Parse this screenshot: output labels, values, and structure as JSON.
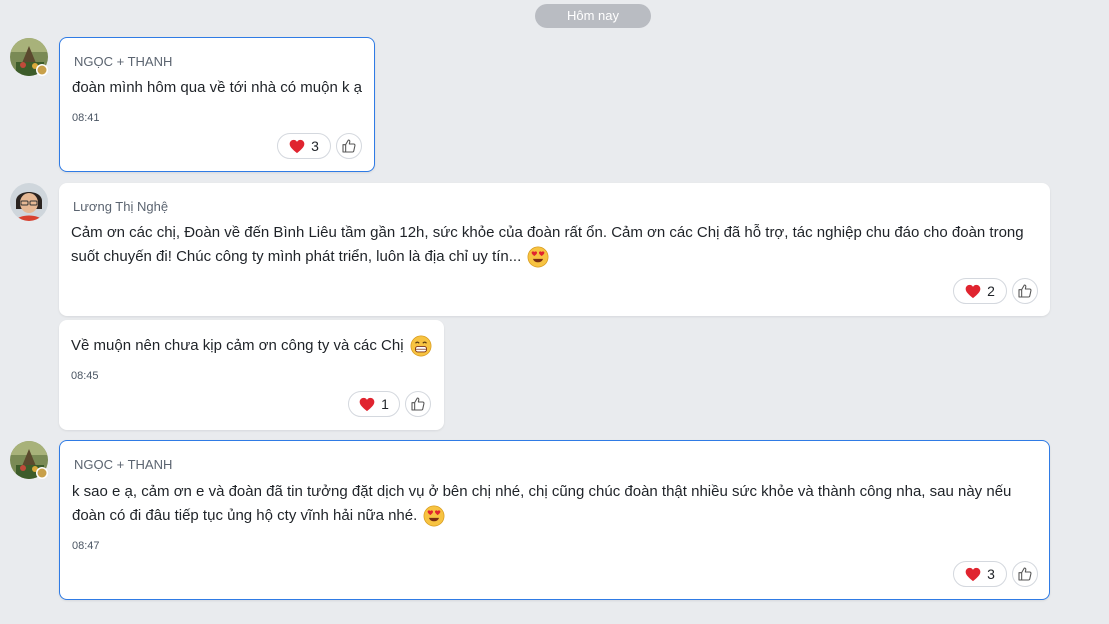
{
  "date_divider": "Hôm nay",
  "messages": [
    {
      "sender": "NGỌC + THANH",
      "line1": "đoàn mình hôm qua về tới nhà có muộn k ạ",
      "time": "08:41",
      "reaction_icon": "heart-icon",
      "reaction_count": "3"
    },
    {
      "sender": "Lương Thị Nghệ",
      "line1": "Cảm ơn các chị, Đoàn về đến Bình Liêu tầm gần 12h, sức khỏe của đoàn rất ổn. Cảm ơn các Chị đã hỗ trợ, tác nghiệp chu đáo cho đoàn trong",
      "line2": "suốt chuyến đi! Chúc công ty mình phát triển, luôn là địa chỉ uy tín...",
      "emoji": "heart-eyes-emoji",
      "reaction_icon": "heart-icon",
      "reaction_count": "2"
    },
    {
      "line1": "Về muộn nên chưa kịp cảm ơn công ty và các Chị",
      "emoji": "grinning-emoji",
      "time": "08:45",
      "reaction_icon": "heart-icon",
      "reaction_count": "1"
    },
    {
      "sender": "NGỌC + THANH",
      "line1": "k sao e ạ, cảm ơn e và đoàn đã tin tưởng đặt dịch vụ ở bên chị nhé, chị cũng chúc đoàn thật nhiều sức khỏe và thành công nha, sau này nếu",
      "line2": "đoàn có đi đâu tiếp tục ủng hộ cty vĩnh hải nữa nhé.",
      "emoji": "heart-eyes-emoji",
      "time": "08:47",
      "reaction_icon": "heart-icon",
      "reaction_count": "3"
    }
  ],
  "colors": {
    "background": "#e9ebee",
    "own_border": "#2f7be5",
    "heart": "#e0242f"
  }
}
